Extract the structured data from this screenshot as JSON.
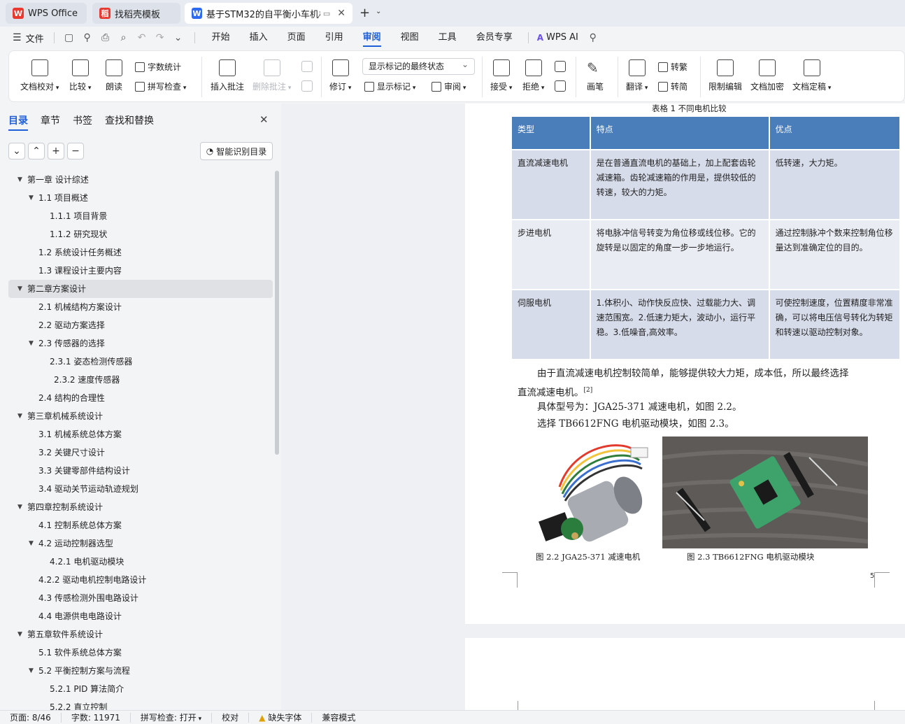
{
  "tabs": [
    {
      "label": "WPS Office",
      "logo": "W"
    },
    {
      "label": "找稻壳模板",
      "logo": "稻"
    },
    {
      "label": "基于STM32的自平衡小车机械",
      "logo": "W"
    }
  ],
  "menu": {
    "file": "文件",
    "items": [
      "开始",
      "插入",
      "页面",
      "引用",
      "审阅",
      "视图",
      "工具",
      "会员专享"
    ],
    "active": "审阅",
    "ai": "WPS AI"
  },
  "ribbon": {
    "doc_check": "文档校对",
    "compare": "比较",
    "read_aloud": "朗读",
    "word_count": "字数统计",
    "spell_check": "拼写检查",
    "insert_comment": "插入批注",
    "delete_comment": "删除批注",
    "revise": "修订",
    "mark_state": "显示标记的最终状态",
    "show_marks": "显示标记",
    "review": "审阅",
    "accept": "接受",
    "reject": "拒绝",
    "pen": "画笔",
    "translate": "翻译",
    "to_traditional": "转繁",
    "to_simplified": "转简",
    "restrict_edit": "限制编辑",
    "doc_encrypt": "文档加密",
    "doc_finalize": "文档定稿"
  },
  "nav": {
    "tabs": [
      "目录",
      "章节",
      "书签",
      "查找和替换"
    ],
    "smart_button": "智能识别目录",
    "toc": [
      {
        "label": "第一章  设计综述",
        "level": 0,
        "expand": true
      },
      {
        "label": "1.1  项目概述",
        "level": 1,
        "expand": true
      },
      {
        "label": "1.1.1  项目背景",
        "level": 2
      },
      {
        "label": "1.1.2  研究现状",
        "level": 2
      },
      {
        "label": "1.2  系统设计任务概述",
        "level": 1
      },
      {
        "label": "1.3  课程设计主要内容",
        "level": 1
      },
      {
        "label": "第二章方案设计",
        "level": 0,
        "expand": true,
        "selected": true
      },
      {
        "label": "2.1  机械结构方案设计",
        "level": 1
      },
      {
        "label": "2.2  驱动方案选择",
        "level": 1
      },
      {
        "label": "2.3  传感器的选择",
        "level": 1,
        "expand": true
      },
      {
        "label": "2.3.1  姿态检测传感器",
        "level": 2
      },
      {
        "label": "2.3.2  速度传感器",
        "level": 2,
        "indent_extra": true
      },
      {
        "label": "2.4  结构的合理性",
        "level": 1
      },
      {
        "label": "第三章机械系统设计",
        "level": 0,
        "expand": true
      },
      {
        "label": "3.1  机械系统总体方案",
        "level": 1
      },
      {
        "label": "3.2  关键尺寸设计",
        "level": 1
      },
      {
        "label": "3.3  关键零部件结构设计",
        "level": 1
      },
      {
        "label": "3.4  驱动关节运动轨迹规划",
        "level": 1
      },
      {
        "label": "第四章控制系统设计",
        "level": 0,
        "expand": true
      },
      {
        "label": "4.1  控制系统总体方案",
        "level": 1
      },
      {
        "label": "4.2  运动控制器选型",
        "level": 1,
        "expand": true
      },
      {
        "label": "4.2.1  电机驱动模块",
        "level": 2
      },
      {
        "label": "4.2.2  驱动电机控制电路设计",
        "level": 1
      },
      {
        "label": "4.3  传感检测外围电路设计",
        "level": 1
      },
      {
        "label": "4.4  电源供电电路设计",
        "level": 1
      },
      {
        "label": "第五章软件系统设计",
        "level": 0,
        "expand": true
      },
      {
        "label": "5.1  软件系统总体方案",
        "level": 1
      },
      {
        "label": "5.2  平衡控制方案与流程",
        "level": 1,
        "expand": true
      },
      {
        "label": "5.2.1 PID 算法简介",
        "level": 2
      },
      {
        "label": "5.2.2  直立控制",
        "level": 2
      }
    ]
  },
  "document": {
    "table_caption": "表格  1  不同电机比较",
    "table": {
      "headers": [
        "类型",
        "特点",
        "优点"
      ],
      "rows": [
        [
          "直流减速电机",
          "是在普通直流电机的基础上，加上配套齿轮减速箱。齿轮减速箱的作用是，提供较低的转速，较大的力矩。",
          "低转速，大力矩。"
        ],
        [
          "步进电机",
          "将电脉冲信号转变为角位移或线位移。它的旋转是以固定的角度一步一步地运行。",
          "通过控制脉冲个数来控制角位移量达到准确定位的目的。"
        ],
        [
          "伺服电机",
          "1.体积小、动作快反应快、过载能力大、调速范围宽。2.低速力矩大，波动小，运行平稳。3.低噪音,高效率。",
          "可使控制速度，位置精度非常准确，可以将电压信号转化为转矩和转速以驱动控制对象。"
        ]
      ]
    },
    "para1_line1": "由于直流减速电机控制较简单，能够提供较大力矩，成本低，所以最终选择",
    "para1_line2": "直流减速电机。",
    "para1_ref": "[2]",
    "para2": "具体型号为：JGA25-371 减速电机，如图 2.2。",
    "para3": "选择 TB6612FNG 电机驱动模块，如图 2.3。",
    "fig1_caption": "图  2.2 JGA25-371 减速电机",
    "fig2_caption": "图  2.3 TB6612FNG 电机驱动模块",
    "page_number": "5"
  },
  "status": {
    "page": "页面: 8/46",
    "words": "字数: 11971",
    "spell": "拼写检查: 打开",
    "proof": "校对",
    "missing_font": "缺失字体",
    "compat": "兼容模式"
  },
  "colors": {
    "accent": "#1e5fd8",
    "table_header": "#4a7ebb",
    "table_row": "#d7dcea"
  }
}
